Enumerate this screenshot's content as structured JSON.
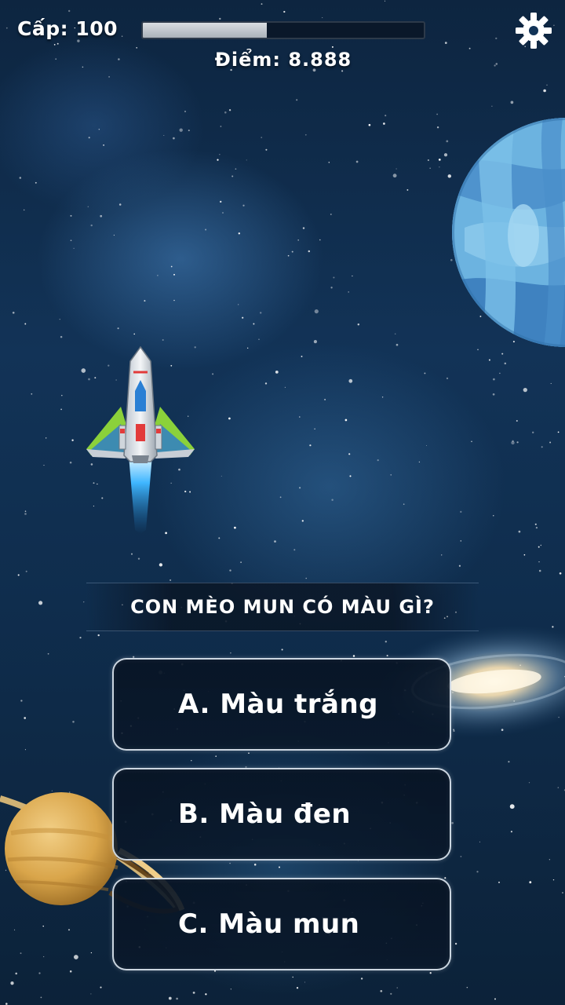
{
  "hud": {
    "level_text": "Cấp: 100",
    "score_text": "Điểm: 8.888",
    "progress_fraction": 0.44,
    "settings_icon": "gear-icon"
  },
  "question": {
    "text": "CON MÈO MUN CÓ MÀU GÌ?"
  },
  "answers": [
    {
      "label": "A. Màu trắng"
    },
    {
      "label": "B. Màu đen"
    },
    {
      "label": "C. Màu mun"
    }
  ],
  "scene": {
    "background_color": "#123357",
    "blue_planet_color": "#5fa6d8",
    "saturn_color": "#d9a54a",
    "ship_accent_color": "#8bd13a",
    "ship_flame_color": "#3fb6ff",
    "icons": [
      "blue-planet",
      "saturn-planet",
      "spiral-galaxy",
      "player-spaceship"
    ]
  }
}
